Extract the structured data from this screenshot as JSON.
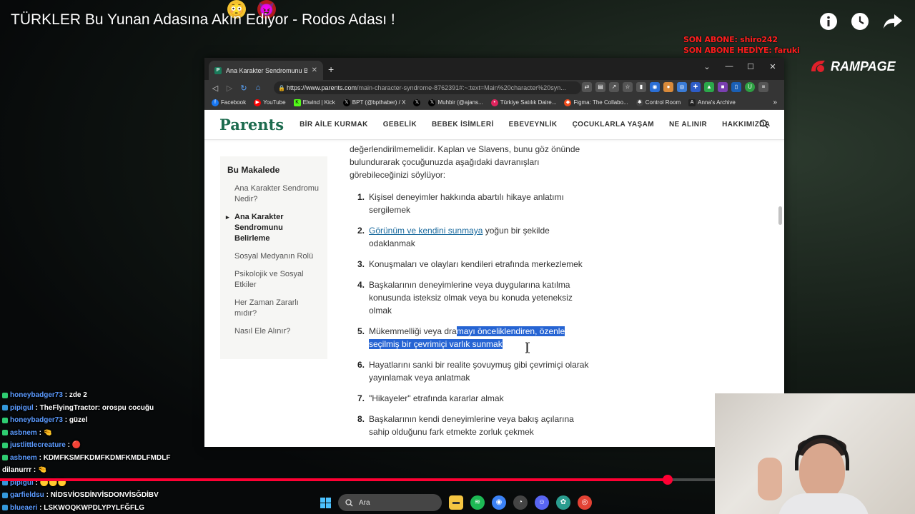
{
  "video": {
    "title": "TÜRKLER Bu Yunan Adasına Akın Ediyor - Rodos Adası !",
    "sub_last": "SON ABONE: shiro242",
    "sub_gift": "SON ABONE HEDİYE: faruki",
    "brand": "RAMPAGE",
    "progress_percent": 73
  },
  "browser": {
    "tab_title": "Ana Karakter Sendromunu Belirleme",
    "url_host": "https://www.parents.com",
    "url_path": "/main-character-syndrome-8762391#:~:text=Main%20character%20syn...",
    "bookmarks": [
      "Facebook",
      "YouTube",
      "Elwind | Kick",
      "BPT (@bpthaber) / X",
      "",
      "Muhbir (@ajans...",
      "Türkiye Satılık Daire...",
      "Figma: The Collabo...",
      "Control Room",
      "Anna's Archive"
    ],
    "bookmark_colors": [
      "#1877f2",
      "#ff0000",
      "#53fc18",
      "#000000",
      "#000000",
      "#000000",
      "#e0245e",
      "#f24e1e",
      "#444444",
      "#222222"
    ]
  },
  "site": {
    "logo": "Parents",
    "nav": [
      "BİR AİLE KURMAK",
      "GEBELİK",
      "BEBEK İSİMLERİ",
      "EBEVEYNLİK",
      "ÇOCUKLARLA YAŞAM",
      "NE ALINIR",
      "HAKKIMIZDA"
    ]
  },
  "toc": {
    "heading": "Bu Makalede",
    "items": [
      "Ana Karakter Sendromu Nedir?",
      "Ana Karakter Sendromunu Belirleme",
      "Sosyal Medyanın Rolü",
      "Psikolojik ve Sosyal Etkiler",
      "Her Zaman Zararlı mıdır?",
      "Nasıl Ele Alınır?"
    ],
    "active_index": 1
  },
  "article": {
    "intro": "değerlendirilmemelidir. Kaplan ve Slavens, bunu göz önünde bulundurarak çocuğunuzda aşağıdaki davranışları görebileceğinizi söylüyor:",
    "items": [
      {
        "num": "1.",
        "text": "Kişisel deneyimler hakkında abartılı hikaye anlatımı sergilemek"
      },
      {
        "num": "2.",
        "link": "Görünüm ve kendini sunmaya",
        "text": " yoğun bir şekilde odaklanmak"
      },
      {
        "num": "3.",
        "text": "Konuşmaları ve olayları kendileri etrafında merkezlemek"
      },
      {
        "num": "4.",
        "text": "Başkalarının deneyimlerine veya duygularına katılma konusunda isteksiz olmak veya bu konuda yeteneksiz olmak"
      },
      {
        "num": "5.",
        "pre": "Mükemmelliği veya dra",
        "highlight": "mayı önceliklendiren, özenle seçilmiş bir çevrimiçi varlık sunmak"
      },
      {
        "num": "6.",
        "text": "Hayatlarını sanki bir realite şovuymuş gibi çevrimiçi olarak yayınlamak veya anlatmak"
      },
      {
        "num": "7.",
        "text": "\"Hikayeler\" etrafında kararlar almak"
      },
      {
        "num": "8.",
        "text": "Başkalarının kendi deneyimlerine veya bakış açılarına sahip olduğunu fark etmekte zorluk çekmek"
      }
    ]
  },
  "chat": [
    {
      "user": "honeybadger73",
      "msg": "zde 2",
      "badge": "#2ecc71"
    },
    {
      "user": "pipigul",
      "msg": "TheFlyingTractor: orospu cocuğu",
      "badge": "#3498db"
    },
    {
      "user": "honeybadger73",
      "msg": "güzel",
      "badge": "#2ecc71"
    },
    {
      "user": "asbnem",
      "msg": "",
      "badge": "#2ecc71"
    },
    {
      "user": "justlittlecreature",
      "msg": "",
      "badge": "#2ecc71"
    },
    {
      "user": "asbnem",
      "msg": "KDMFKSMFKDMFKDMFKMDLFMDLF",
      "badge": "#2ecc71"
    },
    {
      "user": "dilanurrr",
      "msg": "",
      "badge": ""
    },
    {
      "user": "pipigul",
      "msg": "",
      "badge": "#3498db"
    },
    {
      "user": "garfieldsu",
      "msg": "NİDSVİOSDİNVİSDONVİSĞDİBV",
      "badge": "#3498db"
    },
    {
      "user": "blueaeri",
      "msg": "LSKWOQKWPDLYPYLFĞFLG",
      "badge": "#3498db"
    }
  ],
  "taskbar": {
    "search_placeholder": "Ara"
  }
}
